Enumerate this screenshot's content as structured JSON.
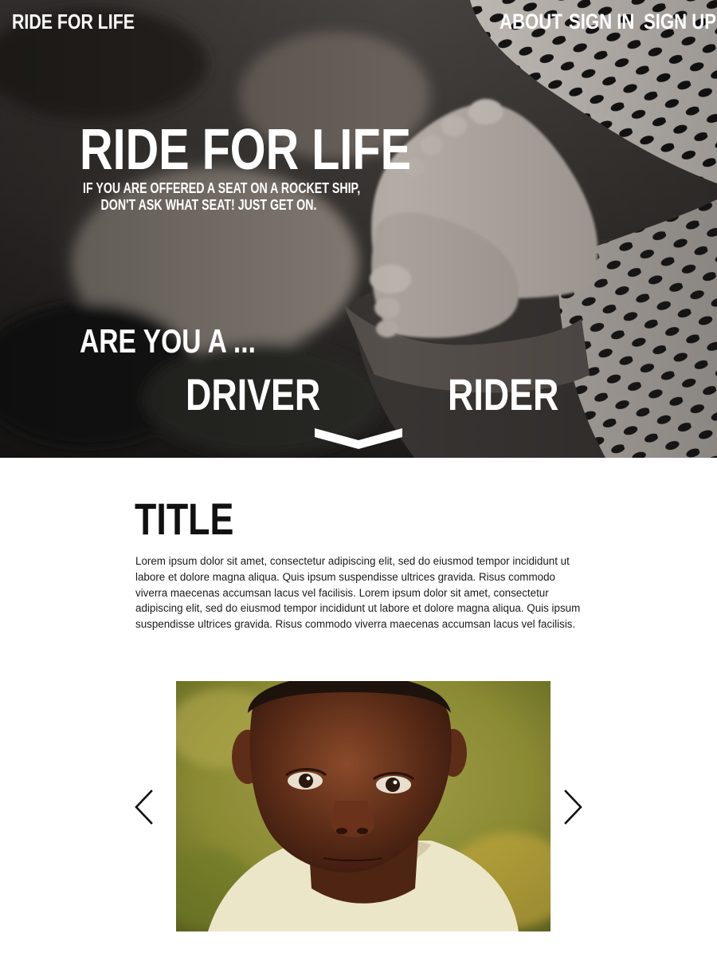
{
  "header": {
    "brand": "RIDE FOR LIFE",
    "nav": {
      "about": "ABOUT",
      "sign_in": "SIGN IN",
      "sign_up": "SIGN UP"
    }
  },
  "hero": {
    "title": "RIDE FOR LIFE",
    "tagline_line1": "IF YOU ARE OFFERED A SEAT ON A ROCKET SHIP,",
    "tagline_line2": "DON'T ASK WHAT SEAT! JUST GET ON.",
    "question": "ARE YOU A ...",
    "option_driver": "DRIVER",
    "option_rider": "RIDER",
    "scroll_icon": "chevron-down-icon"
  },
  "content": {
    "title": "TITLE",
    "paragraph": "Lorem ipsum dolor sit amet, consectetur adipiscing elit, sed do eiusmod tempor incididunt ut labore et dolore magna aliqua. Quis ipsum suspendisse ultrices gravida. Risus commodo viverra maecenas accumsan lacus vel facilisis. Lorem ipsum dolor sit amet, consectetur adipiscing elit, sed do eiusmod tempor incididunt ut labore et dolore magna aliqua. Quis ipsum suspendisse ultrices gravida. Risus commodo viverra maecenas accumsan lacus vel facilisis."
  },
  "carousel": {
    "prev_icon": "chevron-left-icon",
    "next_icon": "chevron-right-icon"
  },
  "colors": {
    "hero_text": "#ffffff",
    "title_text": "#111111",
    "body_text": "#1a1a1a",
    "page_bg": "#ffffff"
  }
}
